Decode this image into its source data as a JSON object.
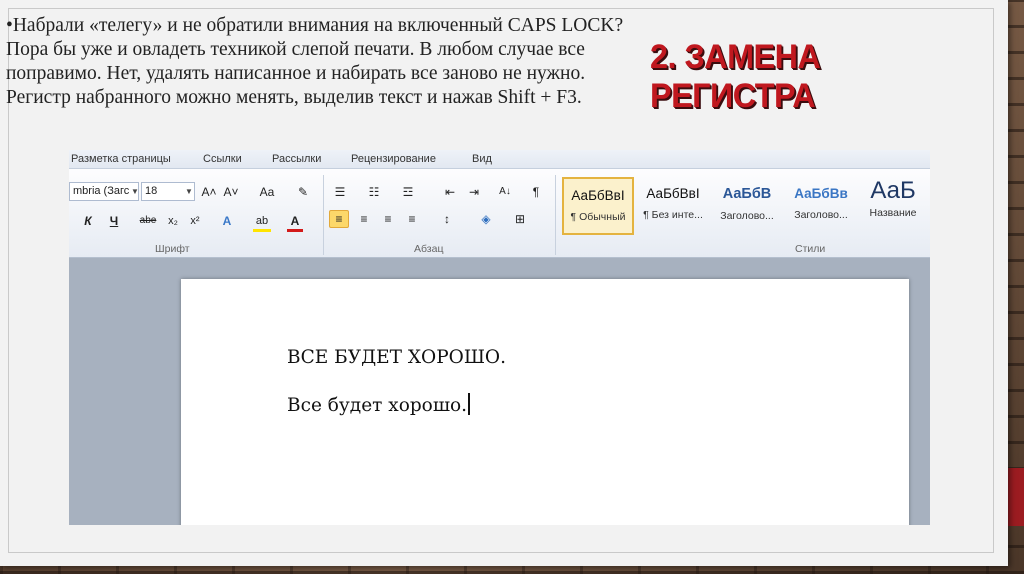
{
  "slide": {
    "body_text": "•Набрали «телегу» и не обратили внимания на включенный CAPS LOCK? Пора бы уже и овладеть техникой слепой печати. В любом случае все поправимо. Нет, удалять написанное и набирать все заново не нужно. Регистр набранного можно менять, выделив текст и нажав Shift + F3.",
    "heading": "2. ЗАМЕНА РЕГИСТРА"
  },
  "word": {
    "tabs": [
      "Разметка страницы",
      "Ссылки",
      "Рассылки",
      "Рецензирование",
      "Вид"
    ],
    "font": {
      "family": "mbria (Загс",
      "size": "18",
      "grow": "A˄",
      "shrink": "A˅",
      "change_case": "Aa",
      "clear": "✎",
      "italic": "К",
      "underline": "Ч",
      "strike": "abe",
      "subscript": "x₂",
      "superscript": "x²",
      "effects": "A",
      "highlight": "ab",
      "color": "A",
      "group_label": "Шрифт"
    },
    "paragraph": {
      "bullets": "☰",
      "numbering": "☷",
      "multilevel": "☲",
      "decrease_indent": "⇤",
      "increase_indent": "⇥",
      "sort": "A↓",
      "show_marks": "¶",
      "align_left": "≡",
      "align_center": "≡",
      "align_right": "≡",
      "justify": "≡",
      "line_spacing": "↕",
      "shading": "◈",
      "borders": "⊞",
      "group_label": "Абзац"
    },
    "styles": {
      "items": [
        {
          "sample": "АаБбВвІ",
          "name": "¶ Обычный"
        },
        {
          "sample": "АаБбВвІ",
          "name": "¶ Без инте..."
        },
        {
          "sample": "АаБбВ",
          "name": "Заголово..."
        },
        {
          "sample": "АаБбВв",
          "name": "Заголово..."
        },
        {
          "sample": "АаБ",
          "name": "Название"
        }
      ],
      "group_label": "Стили"
    },
    "document": {
      "line1": "ВСЕ БУДЕТ ХОРОШО.",
      "line2": "Все будет хорошо."
    }
  },
  "colors": {
    "accent_red": "#c0181f",
    "band_red": "#9c1c21",
    "selected_style": "#e4b33f"
  }
}
